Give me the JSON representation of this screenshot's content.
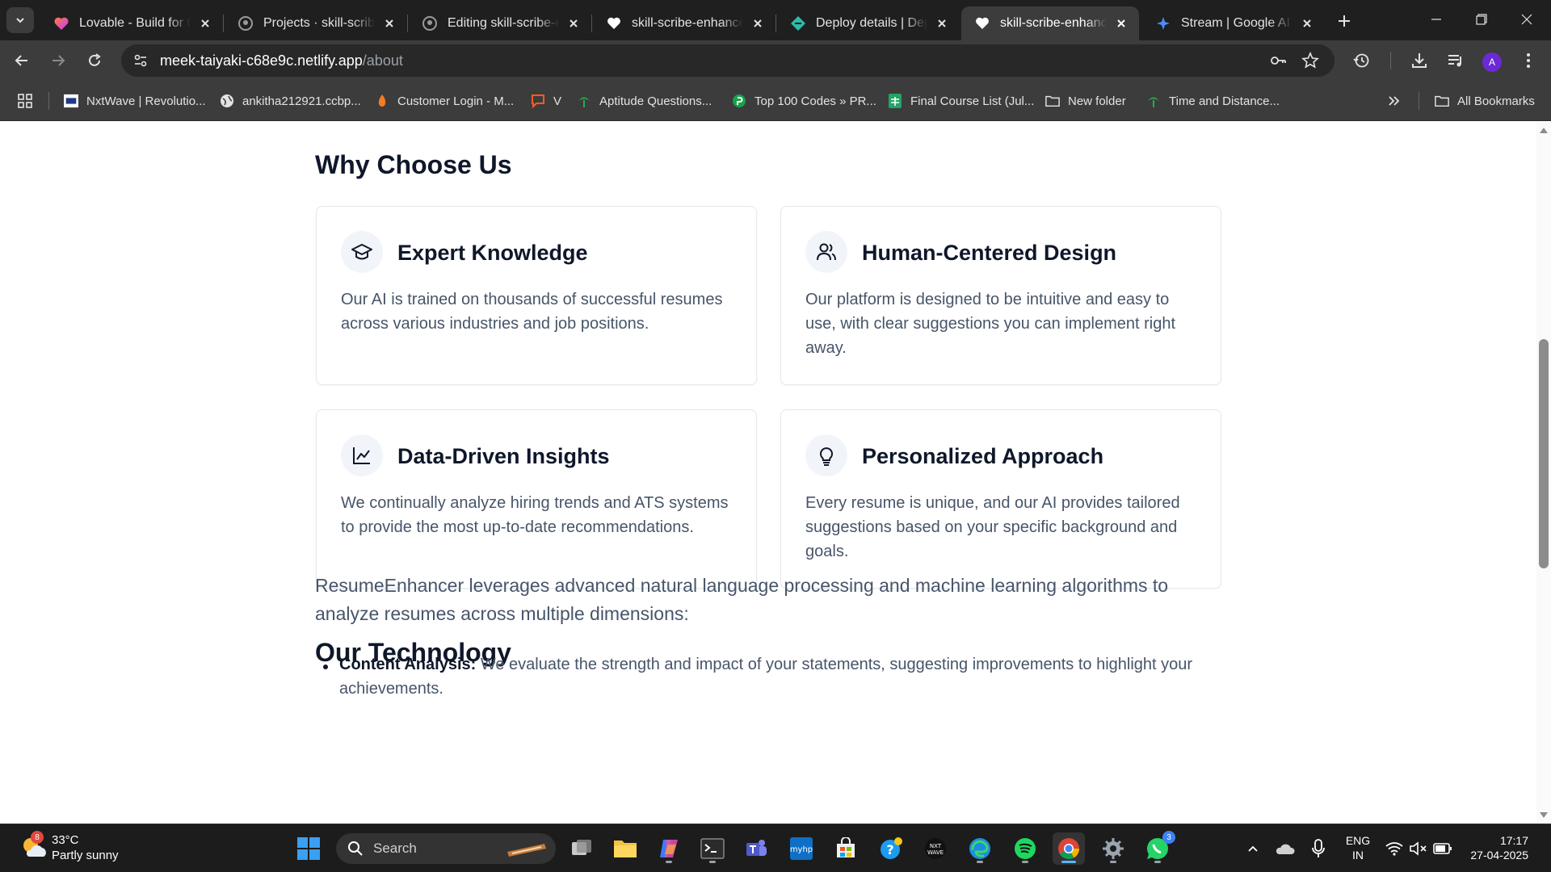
{
  "browser": {
    "tabs": [
      {
        "title": "Lovable - Build for th",
        "icon": "lovable-heart-icon",
        "active": false
      },
      {
        "title": "Projects · skill-scribe",
        "icon": "github-icon",
        "active": false
      },
      {
        "title": "Editing skill-scribe-en",
        "icon": "github-icon",
        "active": false
      },
      {
        "title": "skill-scribe-enhance",
        "icon": "heart-icon",
        "active": false
      },
      {
        "title": "Deploy details | Depl",
        "icon": "netlify-icon",
        "active": false
      },
      {
        "title": "skill-scribe-enhance",
        "icon": "heart-icon",
        "active": true
      },
      {
        "title": "Stream | Google AI St",
        "icon": "google-ai-studio-icon",
        "active": false
      }
    ],
    "address": {
      "host": "meek-taiyaki-c68e9c.netlify.app",
      "path": "/about"
    },
    "profile_initial": "A",
    "bookmarks": [
      {
        "label": "NxtWave | Revolutio...",
        "icon": "nxtwave-icon"
      },
      {
        "label": "ankitha212921.ccbp...",
        "icon": "globe-icon"
      },
      {
        "label": "Customer Login - M...",
        "icon": "flame-icon"
      },
      {
        "label": "V",
        "icon": "chat-icon"
      },
      {
        "label": "Aptitude Questions...",
        "icon": "indiabix-icon"
      },
      {
        "label": "Top 100 Codes » PR...",
        "icon": "prepinsta-icon"
      },
      {
        "label": "Final Course List (Jul...",
        "icon": "sheets-icon"
      },
      {
        "label": "New folder",
        "icon": "folder-icon"
      },
      {
        "label": "Time and Distance...",
        "icon": "indiabix-icon"
      }
    ],
    "all_bookmarks_label": "All Bookmarks"
  },
  "page": {
    "why_heading": "Why Choose Us",
    "cards": [
      {
        "title": "Expert Knowledge",
        "icon": "graduation-cap-icon",
        "body": "Our AI is trained on thousands of successful resumes across various industries and job positions."
      },
      {
        "title": "Human-Centered Design",
        "icon": "users-icon",
        "body": "Our platform is designed to be intuitive and easy to use, with clear suggestions you can implement right away."
      },
      {
        "title": "Data-Driven Insights",
        "icon": "line-chart-icon",
        "body": "We continually analyze hiring trends and ATS systems to provide the most up-to-date recommendations."
      },
      {
        "title": "Personalized Approach",
        "icon": "lightbulb-icon",
        "body": "Every resume is unique, and our AI provides tailored suggestions based on your specific background and goals."
      }
    ],
    "tech_heading": "Our Technology",
    "tech_paragraph": "ResumeEnhancer leverages advanced natural language processing and machine learning algorithms to analyze resumes across multiple dimensions:",
    "tech_items": [
      {
        "label": "Content Analysis:",
        "text": " We evaluate the strength and impact of your statements, suggesting improvements to highlight your achievements."
      }
    ]
  },
  "taskbar": {
    "weather": {
      "temp": "33°C",
      "desc": "Partly sunny",
      "badge": "8"
    },
    "search_placeholder": "Search",
    "whatsapp_badge": "3",
    "lang": {
      "line1": "ENG",
      "line2": "IN"
    },
    "clock": {
      "time": "17:17",
      "date": "27-04-2025"
    }
  }
}
